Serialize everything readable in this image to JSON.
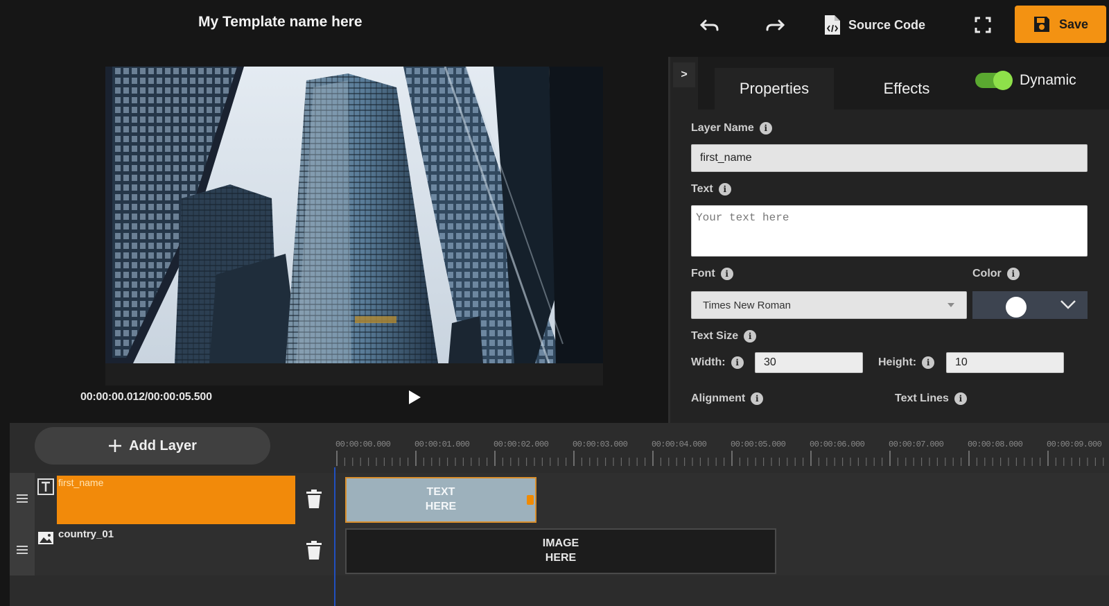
{
  "header": {
    "template_name": "My Template name here",
    "source_code_label": "Source Code",
    "save_label": "Save",
    "icons": [
      "undo-icon",
      "redo-icon",
      "code-file-icon",
      "fullscreen-icon",
      "floppy-disk-icon"
    ]
  },
  "preview": {
    "timecode": "00:00:00.012/00:00:05.500"
  },
  "panel": {
    "collapse_label": ">",
    "tabs": [
      {
        "label": "Properties",
        "active": true
      },
      {
        "label": "Effects",
        "active": false
      }
    ],
    "dynamic_label": "Dynamic",
    "dynamic_enabled": true,
    "layer_name_label": "Layer Name",
    "layer_name_value": "first_name",
    "text_label": "Text",
    "text_placeholder": "Your text here",
    "font_label": "Font",
    "font_value": "Times New Roman",
    "color_label": "Color",
    "color_value": "#ffffff",
    "text_size_label": "Text Size",
    "width_label": "Width:",
    "width_value": "30",
    "height_label": "Height:",
    "height_value": "10",
    "alignment_label": "Alignment",
    "text_lines_label": "Text Lines"
  },
  "timeline": {
    "add_layer_label": "Add Layer",
    "ruler_labels": [
      "00:00:00.000",
      "00:00:01.000",
      "00:00:02.000",
      "00:00:03.000",
      "00:00:04.000",
      "00:00:05.000",
      "00:00:06.000",
      "00:00:07.000",
      "00:00:08.000",
      "00:00:09.000"
    ],
    "layers": [
      {
        "name": "first_name",
        "type": "text",
        "selected": true,
        "clip_label": "TEXT\nHERE"
      },
      {
        "name": "country_01",
        "type": "image",
        "selected": false,
        "clip_label": "IMAGE\nHERE"
      }
    ]
  },
  "colors": {
    "accent": "#f39212",
    "toggle_on": "#5aa830",
    "text_clip": "#9db1bc",
    "playhead": "#2050c0"
  }
}
